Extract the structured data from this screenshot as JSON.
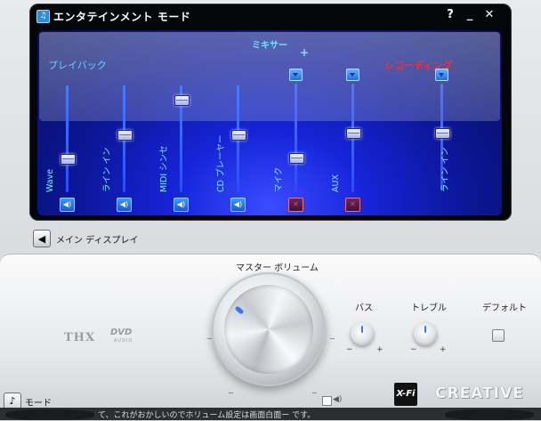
{
  "window": {
    "title": "エンタテインメント モード",
    "help_label": "?",
    "minimize_label": "_",
    "close_label": "✕"
  },
  "mixer": {
    "title": "ミキサー",
    "plus": "+",
    "playback_label": "プレイバック",
    "recording_label": "レコーディング",
    "channels": [
      {
        "name": "Wave",
        "level": 0.7,
        "muted": false,
        "selector": false
      },
      {
        "name": "ライン イン",
        "level": 0.45,
        "muted": false,
        "selector": false
      },
      {
        "name": "MIDI シンセ",
        "level": 0.1,
        "muted": false,
        "selector": false
      },
      {
        "name": "CD プレーヤー",
        "level": 0.45,
        "muted": false,
        "selector": false
      },
      {
        "name": "マイク",
        "level": 0.7,
        "muted": true,
        "selector": true
      },
      {
        "name": "AUX",
        "level": 0.45,
        "muted": true,
        "selector": true
      },
      {
        "name": "ライン イン",
        "level": 0.45,
        "muted": false,
        "selector": true,
        "recording_only": true
      }
    ],
    "mute_icon": "speaker-icon",
    "muted_icon": "x-icon",
    "selector_icon": "chevron-down-icon"
  },
  "nav": {
    "main_display_label": "メイン ディスプレイ",
    "back_icon": "arrow-left-icon"
  },
  "controls": {
    "master_volume_label": "マスター ボリューム",
    "bass_label": "バス",
    "treble_label": "トレブル",
    "default_label": "デフォルト",
    "minus": "−",
    "plus": "+",
    "tick_minus": "−"
  },
  "branding": {
    "thx": "THX",
    "dvd": "DVD",
    "dvd_sub": "AUDIO",
    "xfi": "X-Fi",
    "creative": "CREATIVE"
  },
  "bottom": {
    "mode_label": "モード",
    "strip_text": "て、これがおかしいのでホリューム設定は画面白面ー  です。"
  },
  "colors": {
    "accent": "#2d7bff",
    "recording": "#ff2a2a",
    "label_cyan": "#7eeaff"
  }
}
